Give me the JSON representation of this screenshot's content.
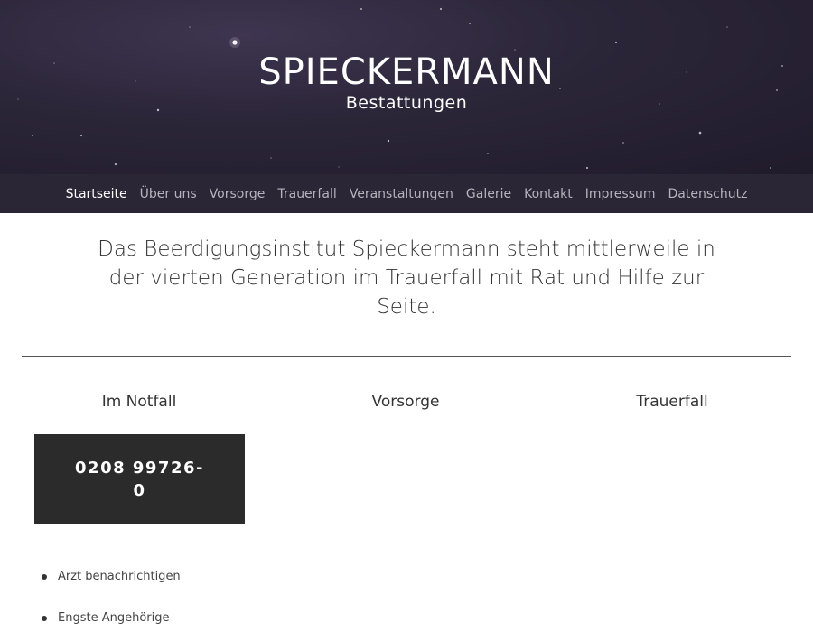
{
  "header": {
    "title": "SPIECKERMANN",
    "subtitle": "Bestattungen"
  },
  "nav": {
    "items": [
      {
        "label": "Startseite"
      },
      {
        "label": "Über uns"
      },
      {
        "label": "Vorsorge"
      },
      {
        "label": "Trauerfall"
      },
      {
        "label": "Veranstaltungen"
      },
      {
        "label": "Galerie"
      },
      {
        "label": "Kontakt"
      },
      {
        "label": "Impressum"
      },
      {
        "label": "Datenschutz"
      }
    ],
    "active": "Startseite"
  },
  "intro": {
    "text": "Das Beerdigungsinstitut Spieckermann steht mittlerweile in der vierten Generation im Trauerfall mit Rat und Hilfe zur Seite."
  },
  "columns": {
    "notfall": {
      "title": "Im Notfall"
    },
    "vorsorge": {
      "title": "Vorsorge"
    },
    "trauerfall": {
      "title": "Trauerfall"
    }
  },
  "phone": {
    "number": "0208 99726-0"
  },
  "notfall_list": [
    {
      "label": "Arzt benachrichtigen"
    },
    {
      "label": "Engste Angehörige"
    }
  ]
}
